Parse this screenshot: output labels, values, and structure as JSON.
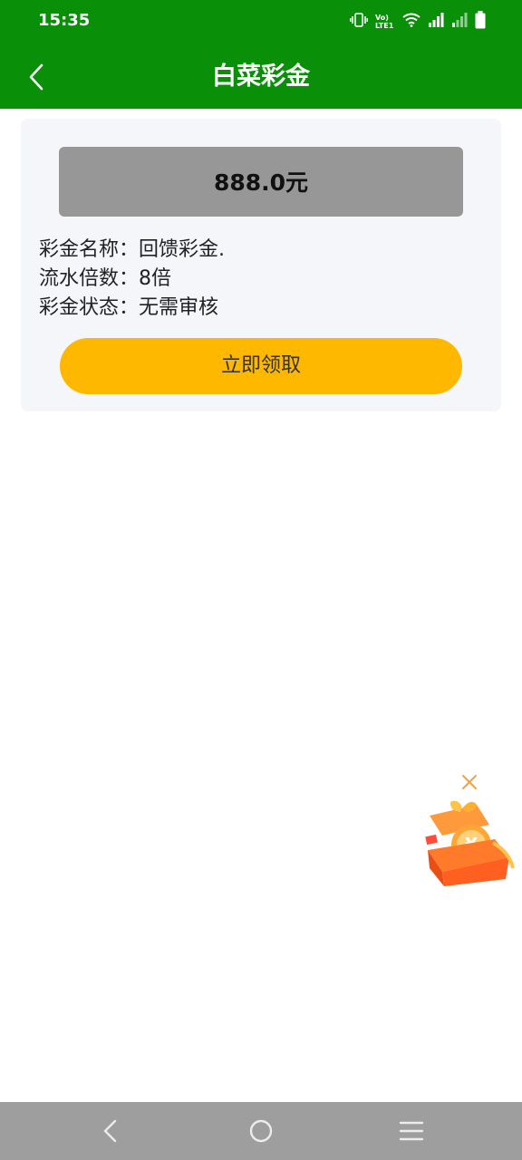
{
  "status_bar": {
    "time": "15:35",
    "icons": [
      "vibrate-icon",
      "volte-icon",
      "wifi-icon",
      "signal-icon",
      "signal-weak-icon",
      "battery-icon"
    ],
    "volte_text": "Vo) LTE1"
  },
  "header": {
    "title": "白菜彩金",
    "back_icon": "chevron-left-icon",
    "background": "#0a8f08"
  },
  "bonus_card": {
    "amount": "888.0元",
    "name_line": "彩金名称：回馈彩金.",
    "turnover_line": "流水倍数：8倍",
    "status_line": "彩金状态：无需审核",
    "claim_label": "立即领取",
    "claim_color": "#ffb800"
  },
  "floating_gift": {
    "close_icon": "close-icon",
    "gift_icon": "gift-box-icon",
    "symbol": "¥"
  },
  "system_nav": {
    "icons": [
      "back-icon",
      "home-icon",
      "menu-icon"
    ]
  }
}
